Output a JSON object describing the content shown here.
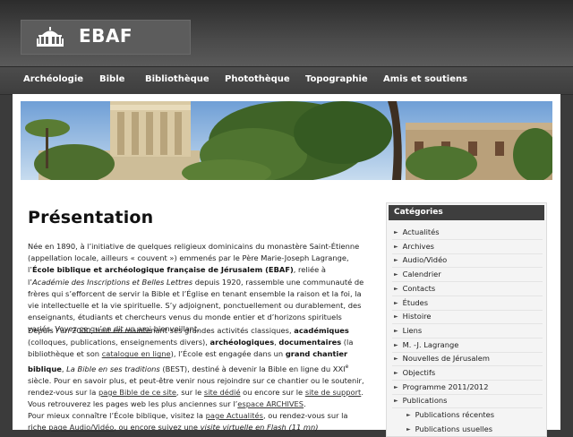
{
  "header": {
    "logo_text": "EBAF"
  },
  "nav": {
    "items": [
      "Archéologie",
      "Bible",
      "Bibliothèque",
      "Photothèque",
      "Topographie",
      "Amis et soutiens"
    ]
  },
  "main": {
    "title": "Présentation",
    "p1": {
      "t1": "Née en 1890, à l’initiative de quelques religieux dominicains du monastère Saint-Étienne (appellation locale, ailleurs « couvent ») emmenés par le Père Marie-Joseph Lagrange, l’",
      "b1": "École biblique et archéologique française de Jérusalem (EBAF)",
      "t2": ", reliée à l’",
      "i1": "Académie des Inscriptions et Belles Lettres",
      "t3": " depuis 1920, rassemble une communauté de frères qui s’efforcent de servir la Bible et l’Église en tenant ensemble la raison et la foi, la vie intellectuelle et la vie spirituelle.   S’y adjoignent, ponctuellement ou durablement, des enseignants, étudiants et chercheurs venus du monde entier et d’horizons spirituels variés. Voyez ",
      "link1": "ce qu’en dit un ami",
      "t4": " bienveillant."
    },
    "p2": {
      "t1": "Depuis l’an 2000, tout en maintenant ses grandes activités classiques, ",
      "b1": "académiques",
      "t2": " (colloques, publications, enseignements divers), ",
      "b2": "archéologiques",
      "t3": ", ",
      "b3": "documentaires",
      "t4": " (la bibliothèque et son ",
      "link1": "catalogue en ligne",
      "t5": "), l’École est engagée dans un ",
      "b4": "grand chantier biblique",
      "t6": ", ",
      "i1": "La Bible en ses traditions",
      "t7": " (BEST), destiné à devenir la Bible en ligne du XXI",
      "sup1": "e",
      "t8": " siècle. Pour en savoir plus, et peut-être venir nous rejoindre sur ce chantier ou le soutenir, rendez-vous sur la ",
      "link2": "page Bible de ce site",
      "t9": ", sur le ",
      "link3": "site dédié",
      "t10": " ou encore sur le ",
      "link4": "site de support",
      "t11": ". Vous retrouverez les pages web les plus anciennes sur l’",
      "link5": "espace ARCHIVES",
      "t12": "."
    },
    "p3": {
      "t1": "Pour mieux connaître l’École biblique, visitez la ",
      "link1": "page Actualités",
      "t2": ", ou rendez-vous sur la riche ",
      "link2": "page Audio/Vidéo",
      "t3": ", ou encore suivez une ",
      "i1": "visite virtuelle en Flash (11 mn)"
    }
  },
  "sidebar": {
    "heading": "Catégories",
    "items": [
      {
        "label": "Actualités"
      },
      {
        "label": "Archives"
      },
      {
        "label": "Audio/Vidéo"
      },
      {
        "label": "Calendrier"
      },
      {
        "label": "Contacts"
      },
      {
        "label": "Études"
      },
      {
        "label": "Histoire"
      },
      {
        "label": "Liens"
      },
      {
        "label": "M. -J. Lagrange"
      },
      {
        "label": "Nouvelles de Jérusalem"
      },
      {
        "label": "Objectifs"
      },
      {
        "label": "Programme 2011/2012"
      },
      {
        "label": "Publications"
      }
    ],
    "sub_items": [
      {
        "label": "Publications récentes"
      },
      {
        "label": "Publications usuelles"
      }
    ]
  },
  "colors": {
    "header_bg": "#3a3a3a",
    "nav_bg": "#454545",
    "sidebar_head_bg": "#3e3e3e",
    "page_bg": "#ffffff"
  }
}
